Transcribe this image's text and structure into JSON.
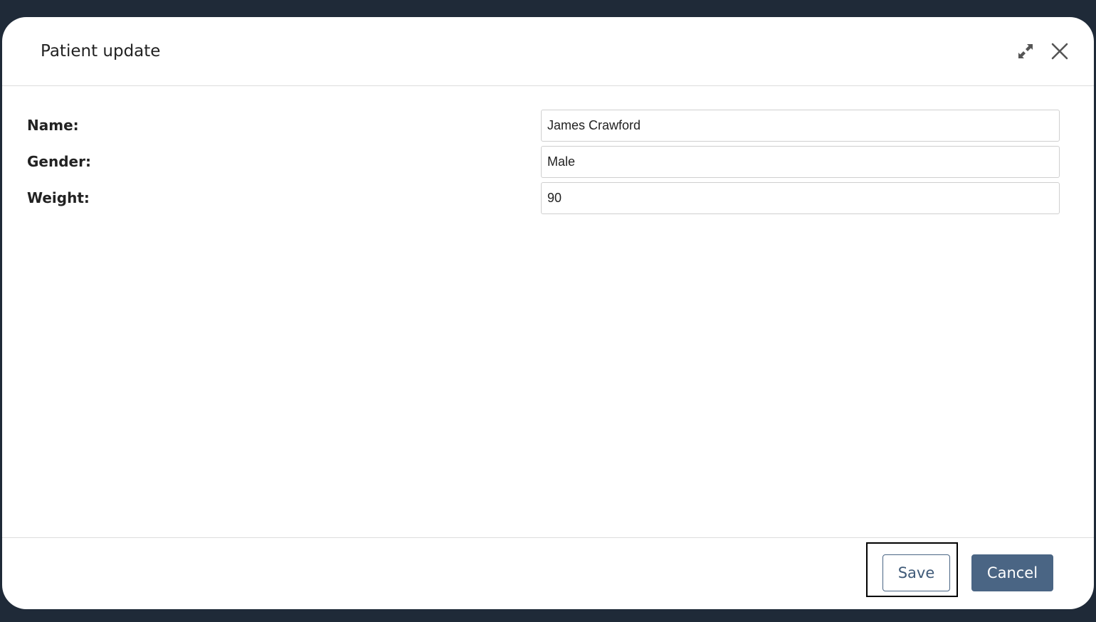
{
  "dialog": {
    "title": "Patient update"
  },
  "header_icons": {
    "expand": "expand-icon",
    "close": "close-icon"
  },
  "form": {
    "fields": [
      {
        "label": "Name:",
        "value": "James Crawford"
      },
      {
        "label": "Gender:",
        "value": "Male"
      },
      {
        "label": "Weight:",
        "value": "90"
      }
    ]
  },
  "footer": {
    "save_label": "Save",
    "cancel_label": "Cancel"
  },
  "colors": {
    "primary": "#4a6584",
    "backdrop": "#1f2a38"
  }
}
